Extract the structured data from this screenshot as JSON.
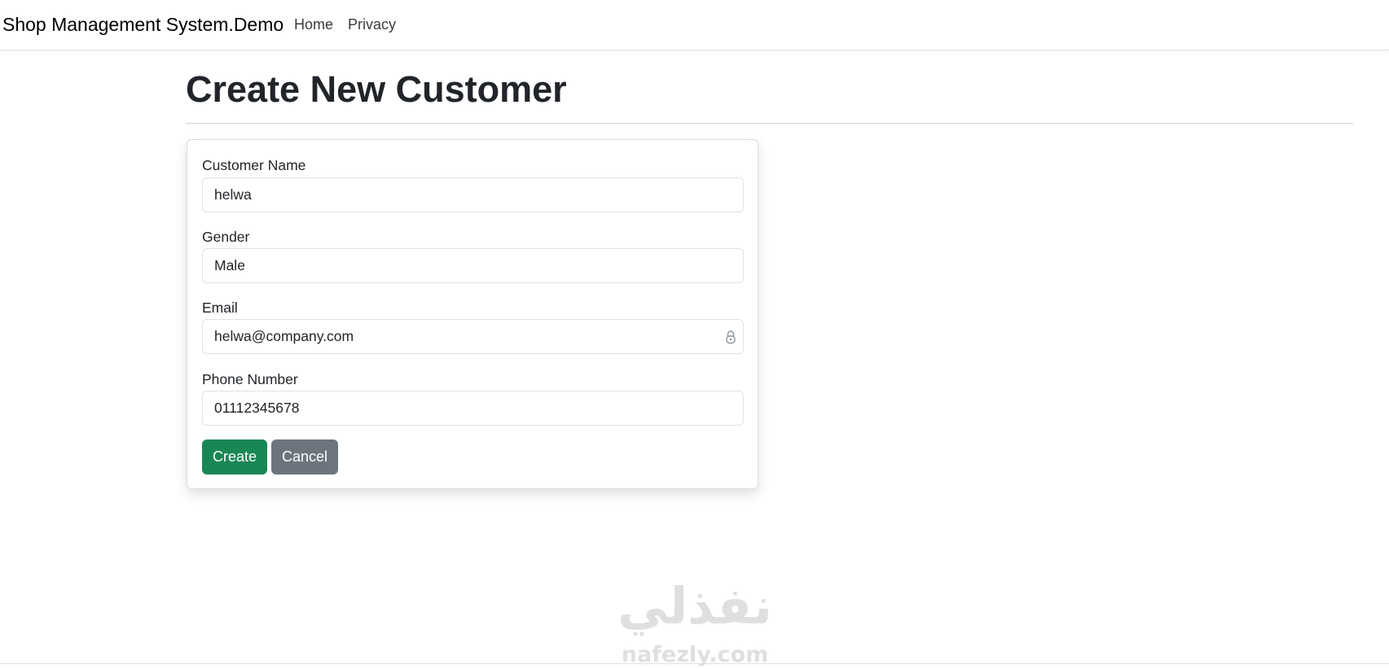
{
  "navbar": {
    "brand": "Shop Management System.Demo",
    "links": [
      {
        "label": "Home"
      },
      {
        "label": "Privacy"
      }
    ]
  },
  "page": {
    "title": "Create New Customer"
  },
  "form": {
    "fields": [
      {
        "label": "Customer Name",
        "value": "helwa"
      },
      {
        "label": "Gender",
        "value": "Male"
      },
      {
        "label": "Email",
        "value": "helwa@company.com",
        "icon": "lock-icon"
      },
      {
        "label": "Phone Number",
        "value": "01112345678"
      }
    ],
    "buttons": {
      "create": "Create",
      "cancel": "Cancel"
    }
  },
  "watermark": {
    "arabic": "نفذلي",
    "latin": "nafezly.com"
  },
  "colors": {
    "create_button": "#198754",
    "cancel_button": "#6c757d"
  }
}
